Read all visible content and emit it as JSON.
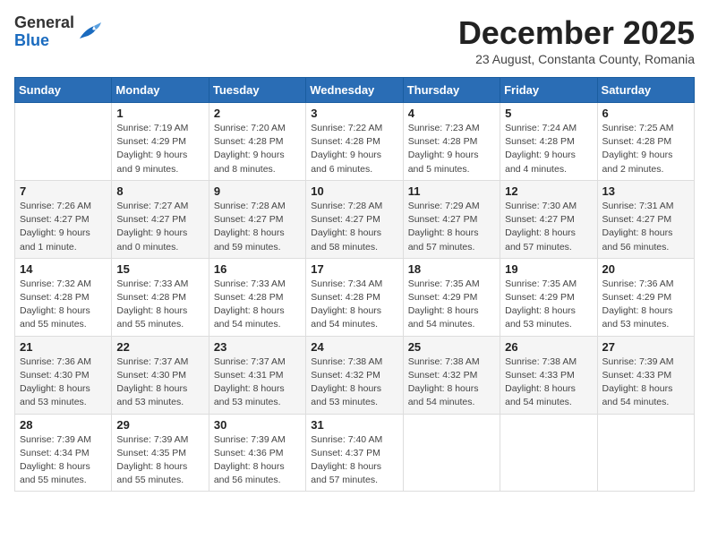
{
  "logo": {
    "general": "General",
    "blue": "Blue"
  },
  "header": {
    "month_title": "December 2025",
    "subtitle": "23 August, Constanta County, Romania"
  },
  "weekdays": [
    "Sunday",
    "Monday",
    "Tuesday",
    "Wednesday",
    "Thursday",
    "Friday",
    "Saturday"
  ],
  "weeks": [
    [
      {
        "day": "",
        "info": ""
      },
      {
        "day": "1",
        "info": "Sunrise: 7:19 AM\nSunset: 4:29 PM\nDaylight: 9 hours\nand 9 minutes."
      },
      {
        "day": "2",
        "info": "Sunrise: 7:20 AM\nSunset: 4:28 PM\nDaylight: 9 hours\nand 8 minutes."
      },
      {
        "day": "3",
        "info": "Sunrise: 7:22 AM\nSunset: 4:28 PM\nDaylight: 9 hours\nand 6 minutes."
      },
      {
        "day": "4",
        "info": "Sunrise: 7:23 AM\nSunset: 4:28 PM\nDaylight: 9 hours\nand 5 minutes."
      },
      {
        "day": "5",
        "info": "Sunrise: 7:24 AM\nSunset: 4:28 PM\nDaylight: 9 hours\nand 4 minutes."
      },
      {
        "day": "6",
        "info": "Sunrise: 7:25 AM\nSunset: 4:28 PM\nDaylight: 9 hours\nand 2 minutes."
      }
    ],
    [
      {
        "day": "7",
        "info": "Sunrise: 7:26 AM\nSunset: 4:27 PM\nDaylight: 9 hours\nand 1 minute."
      },
      {
        "day": "8",
        "info": "Sunrise: 7:27 AM\nSunset: 4:27 PM\nDaylight: 9 hours\nand 0 minutes."
      },
      {
        "day": "9",
        "info": "Sunrise: 7:28 AM\nSunset: 4:27 PM\nDaylight: 8 hours\nand 59 minutes."
      },
      {
        "day": "10",
        "info": "Sunrise: 7:28 AM\nSunset: 4:27 PM\nDaylight: 8 hours\nand 58 minutes."
      },
      {
        "day": "11",
        "info": "Sunrise: 7:29 AM\nSunset: 4:27 PM\nDaylight: 8 hours\nand 57 minutes."
      },
      {
        "day": "12",
        "info": "Sunrise: 7:30 AM\nSunset: 4:27 PM\nDaylight: 8 hours\nand 57 minutes."
      },
      {
        "day": "13",
        "info": "Sunrise: 7:31 AM\nSunset: 4:27 PM\nDaylight: 8 hours\nand 56 minutes."
      }
    ],
    [
      {
        "day": "14",
        "info": "Sunrise: 7:32 AM\nSunset: 4:28 PM\nDaylight: 8 hours\nand 55 minutes."
      },
      {
        "day": "15",
        "info": "Sunrise: 7:33 AM\nSunset: 4:28 PM\nDaylight: 8 hours\nand 55 minutes."
      },
      {
        "day": "16",
        "info": "Sunrise: 7:33 AM\nSunset: 4:28 PM\nDaylight: 8 hours\nand 54 minutes."
      },
      {
        "day": "17",
        "info": "Sunrise: 7:34 AM\nSunset: 4:28 PM\nDaylight: 8 hours\nand 54 minutes."
      },
      {
        "day": "18",
        "info": "Sunrise: 7:35 AM\nSunset: 4:29 PM\nDaylight: 8 hours\nand 54 minutes."
      },
      {
        "day": "19",
        "info": "Sunrise: 7:35 AM\nSunset: 4:29 PM\nDaylight: 8 hours\nand 53 minutes."
      },
      {
        "day": "20",
        "info": "Sunrise: 7:36 AM\nSunset: 4:29 PM\nDaylight: 8 hours\nand 53 minutes."
      }
    ],
    [
      {
        "day": "21",
        "info": "Sunrise: 7:36 AM\nSunset: 4:30 PM\nDaylight: 8 hours\nand 53 minutes."
      },
      {
        "day": "22",
        "info": "Sunrise: 7:37 AM\nSunset: 4:30 PM\nDaylight: 8 hours\nand 53 minutes."
      },
      {
        "day": "23",
        "info": "Sunrise: 7:37 AM\nSunset: 4:31 PM\nDaylight: 8 hours\nand 53 minutes."
      },
      {
        "day": "24",
        "info": "Sunrise: 7:38 AM\nSunset: 4:32 PM\nDaylight: 8 hours\nand 53 minutes."
      },
      {
        "day": "25",
        "info": "Sunrise: 7:38 AM\nSunset: 4:32 PM\nDaylight: 8 hours\nand 54 minutes."
      },
      {
        "day": "26",
        "info": "Sunrise: 7:38 AM\nSunset: 4:33 PM\nDaylight: 8 hours\nand 54 minutes."
      },
      {
        "day": "27",
        "info": "Sunrise: 7:39 AM\nSunset: 4:33 PM\nDaylight: 8 hours\nand 54 minutes."
      }
    ],
    [
      {
        "day": "28",
        "info": "Sunrise: 7:39 AM\nSunset: 4:34 PM\nDaylight: 8 hours\nand 55 minutes."
      },
      {
        "day": "29",
        "info": "Sunrise: 7:39 AM\nSunset: 4:35 PM\nDaylight: 8 hours\nand 55 minutes."
      },
      {
        "day": "30",
        "info": "Sunrise: 7:39 AM\nSunset: 4:36 PM\nDaylight: 8 hours\nand 56 minutes."
      },
      {
        "day": "31",
        "info": "Sunrise: 7:40 AM\nSunset: 4:37 PM\nDaylight: 8 hours\nand 57 minutes."
      },
      {
        "day": "",
        "info": ""
      },
      {
        "day": "",
        "info": ""
      },
      {
        "day": "",
        "info": ""
      }
    ]
  ]
}
